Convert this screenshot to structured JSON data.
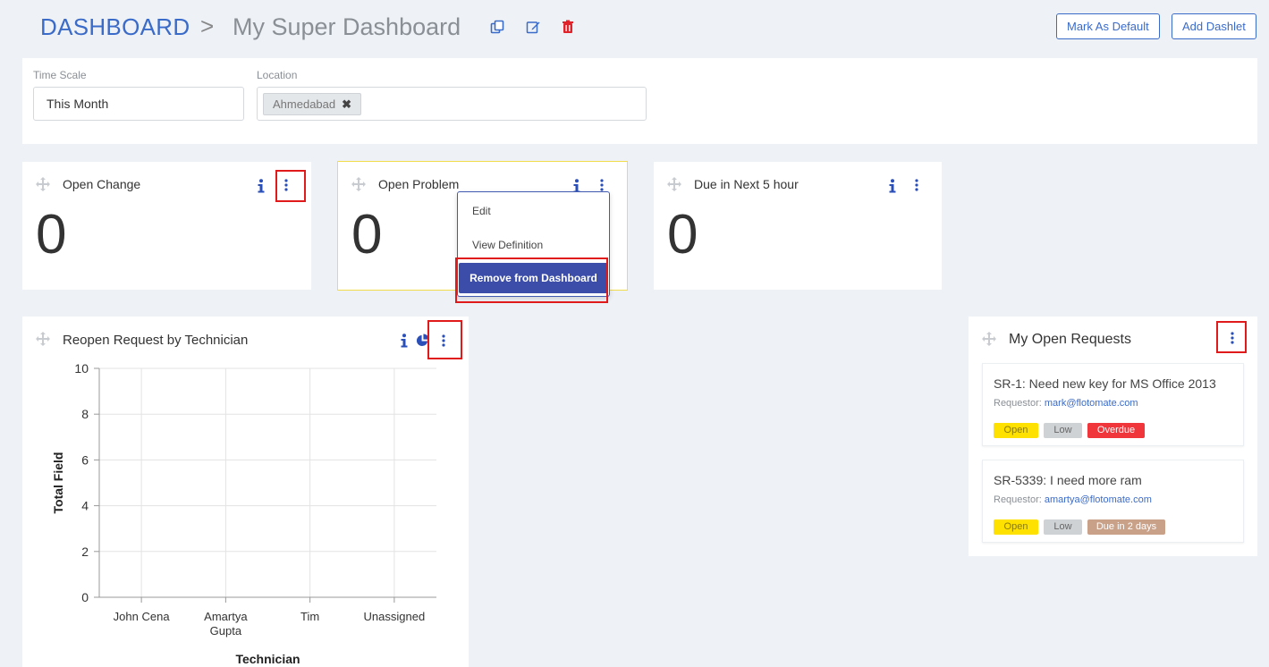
{
  "header": {
    "breadcrumb_root": "DASHBOARD",
    "breadcrumb_sep": ">",
    "dashboard_title": "My Super Dashboard",
    "icons": [
      "copy-icon",
      "edit-icon",
      "delete-icon"
    ],
    "mark_default_label": "Mark As Default",
    "add_dashlet_label": "Add Dashlet"
  },
  "filters": {
    "time_scale_label": "Time Scale",
    "time_scale_value": "This Month",
    "location_label": "Location",
    "location_chip": "Ahmedabad",
    "chip_remove": "✖"
  },
  "dashlets": [
    {
      "title": "Open Change",
      "value": "0"
    },
    {
      "title": "Open Problem",
      "value": "0"
    },
    {
      "title": "Due in Next 5 hour",
      "value": "0"
    }
  ],
  "dropdown": {
    "items": [
      "Edit",
      "View Definition"
    ],
    "primary": "Remove from Dashboard"
  },
  "chart_panel": {
    "title": "Reopen Request by Technician"
  },
  "chart_data": {
    "type": "bar",
    "categories": [
      "John Cena",
      "Amartya Gupta",
      "Tim",
      "Unassigned"
    ],
    "category_lines": [
      [
        "John Cena"
      ],
      [
        "Amartya",
        "Gupta"
      ],
      [
        "Tim"
      ],
      [
        "Unassigned"
      ]
    ],
    "values": [
      0,
      0,
      0,
      0
    ],
    "ylim": [
      0,
      10
    ],
    "yticks": [
      0,
      2,
      4,
      6,
      8,
      10
    ],
    "xlabel": "Technician",
    "ylabel": "Total Field",
    "grid": true
  },
  "requests_panel": {
    "title": "My Open Requests",
    "requests": [
      {
        "title": "SR-1: Need new key for MS Office 2013",
        "requestor_label": "Requestor:",
        "email": "mark@flotomate.com",
        "tags": [
          "Open",
          "Low",
          "Overdue"
        ]
      },
      {
        "title": "SR-5339: I need more ram",
        "requestor_label": "Requestor:",
        "email": "amartya@flotomate.com",
        "tags": [
          "Open",
          "Low",
          "Due in 2 days"
        ]
      }
    ]
  },
  "colors": {
    "accent": "#3b6bc9",
    "tag_open": "#ffe100",
    "tag_low": "#cfd2d4",
    "tag_overdue": "#f0353b",
    "tag_due": "#c9a189",
    "highlight_box": "#e01a1a"
  }
}
